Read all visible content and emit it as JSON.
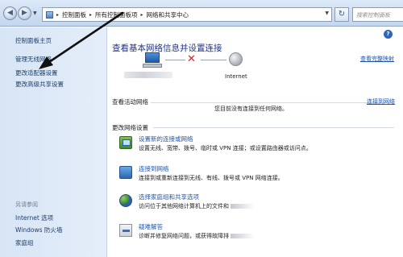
{
  "window": {
    "address": {
      "crumbs": [
        "控制面板",
        "所有控制面板项",
        "网络和共享中心"
      ],
      "separator": "▸"
    },
    "search_placeholder": "搜索控制面板",
    "icons": {
      "back": "back-arrow-icon",
      "forward": "forward-arrow-icon",
      "refresh": "refresh-icon",
      "help": "help-icon"
    }
  },
  "sidebar": {
    "home": "控制面板主页",
    "items": [
      "管理无线网络",
      "更改适配器设置",
      "更改高级共享设置"
    ],
    "see_also_heading": "另请参阅",
    "see_also": [
      "Internet 选项",
      "Windows 防火墙",
      "家庭组"
    ]
  },
  "main": {
    "title": "查看基本网络信息并设置连接",
    "full_map_link": "查看完整映射",
    "map": {
      "internet_label": "Internet",
      "status": "disconnected"
    },
    "active": {
      "heading": "查看活动网络",
      "connect_link": "连接到网络",
      "message": "您目前没有连接到任何网络。"
    },
    "change": {
      "heading": "更改网络设置",
      "tasks": [
        {
          "icon": "network-setup-icon",
          "title": "设置新的连接或网络",
          "desc": "设置无线、宽带、拨号、临时或 VPN 连接；或设置路由器或访问点。"
        },
        {
          "icon": "connect-network-icon",
          "title": "连接到网络",
          "desc": "连接到或重新连接到无线、有线、拨号或 VPN 网络连接。"
        },
        {
          "icon": "homegroup-icon",
          "title": "选择家庭组和共享选项",
          "desc": "访问位于其他网络计算机上的文件和"
        },
        {
          "icon": "troubleshoot-icon",
          "title": "疑难解答",
          "desc": "诊断并修复网络问题，或获得故障排"
        }
      ]
    }
  },
  "colors": {
    "title": "#1e3287",
    "link": "#1d54b0",
    "sidebar_link": "#1c3d6b",
    "disconnect_x": "#d9232d",
    "arrow": "#111111"
  }
}
